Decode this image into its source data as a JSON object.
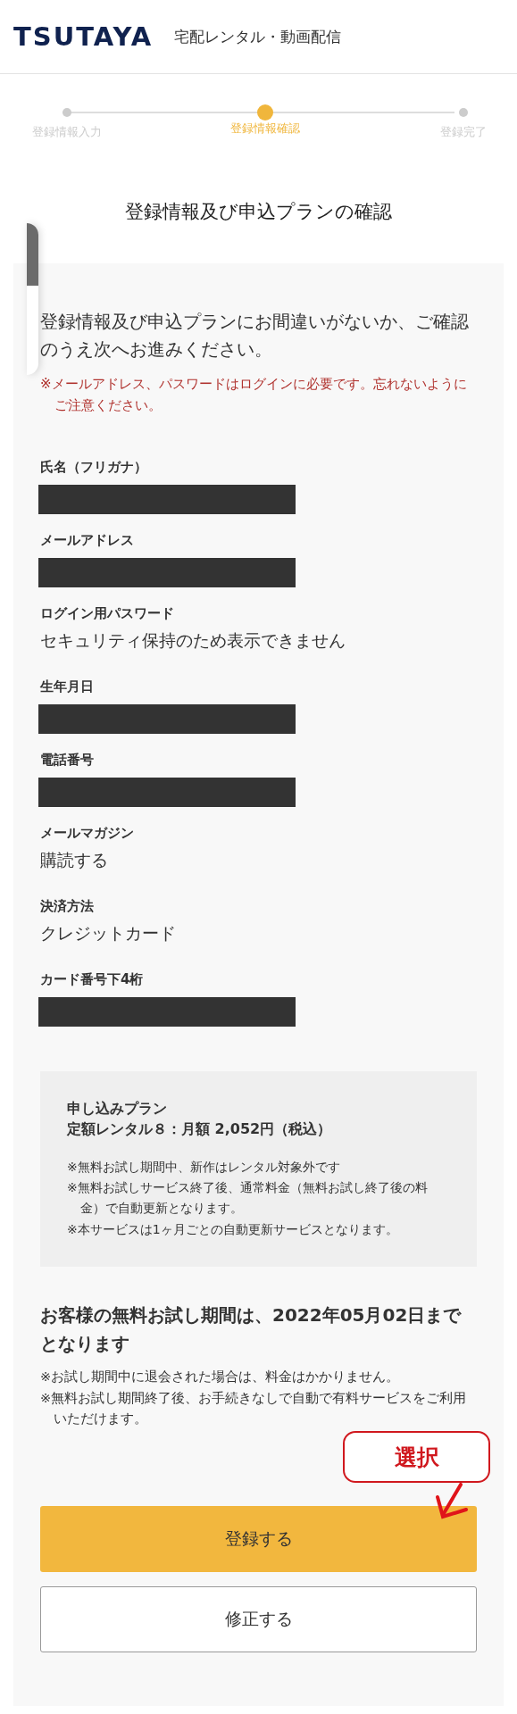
{
  "header": {
    "logo": "TSUTAYA",
    "subtitle": "宅配レンタル・動画配信"
  },
  "steps": [
    {
      "label": "登録情報入力",
      "selected": false
    },
    {
      "label": "登録情報確認",
      "selected": true
    },
    {
      "label": "登録完了",
      "selected": false
    }
  ],
  "title": "登録情報及び申込プランの確認",
  "intro": "登録情報及び申込プランにお間違いがないか、ご確認のうえ次へお進みください。",
  "warning": "※メールアドレス、パスワードはログインに必要です。忘れないようにご注意ください。",
  "fields": [
    {
      "label": "氏名（フリガナ）",
      "kind": "redacted"
    },
    {
      "label": "メールアドレス",
      "kind": "redacted"
    },
    {
      "label": "ログイン用パスワード",
      "kind": "text",
      "value": "セキュリティ保持のため表示できません"
    },
    {
      "label": "生年月日",
      "kind": "redacted"
    },
    {
      "label": "電話番号",
      "kind": "redacted"
    },
    {
      "label": "メールマガジン",
      "kind": "text",
      "value": "購読する"
    },
    {
      "label": "決済方法",
      "kind": "text",
      "value": "クレジットカード"
    },
    {
      "label": "カード番号下4桁",
      "kind": "redacted"
    }
  ],
  "plan": {
    "heading": "申し込みプラン",
    "name": "定額レンタル８：月額 2,052円（税込）",
    "notes": [
      "※無料お試し期間中、新作はレンタル対象外です",
      "※無料お試しサービス終了後、通常料金（無料お試し終了後の料金）で自動更新となります。",
      "※本サービスは1ヶ月ごとの自動更新サービスとなります。"
    ]
  },
  "trial": {
    "message": "お客様の無料お試し期間は、2022年05月02日までとなります",
    "notes": [
      "※お試し期間中に退会された場合は、料金はかかりません。",
      "※無料お試し期間終了後、お手続きなしで自動で有料サービスをご利用いただけます。"
    ]
  },
  "annotation": {
    "label": "選択"
  },
  "buttons": [
    {
      "label": "登録する",
      "kind": "primary"
    },
    {
      "label": "修正する",
      "kind": "secondary"
    }
  ]
}
